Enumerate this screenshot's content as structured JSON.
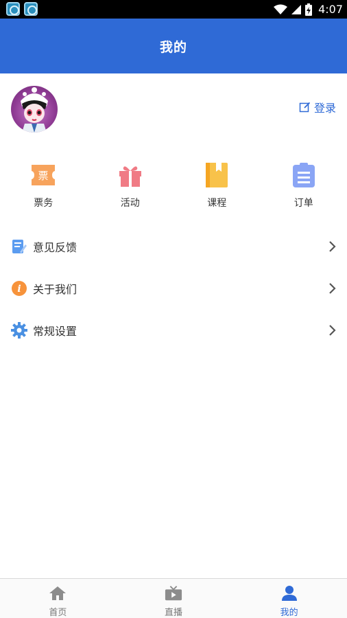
{
  "status_bar": {
    "time": "4:07"
  },
  "header": {
    "title": "我的"
  },
  "profile": {
    "login_label": "登录"
  },
  "shortcuts": [
    {
      "label": "票务",
      "icon": "ticket-icon",
      "color": "#f7a35c",
      "glyph": "票"
    },
    {
      "label": "活动",
      "icon": "gift-icon",
      "color": "#f07b85"
    },
    {
      "label": "课程",
      "icon": "book-icon",
      "color": "#f8c24a"
    },
    {
      "label": "订单",
      "icon": "clipboard-icon",
      "color": "#8aa5f5"
    }
  ],
  "menu": [
    {
      "label": "意见反馈",
      "icon": "feedback-icon"
    },
    {
      "label": "关于我们",
      "icon": "info-icon",
      "glyph": "i"
    },
    {
      "label": "常规设置",
      "icon": "settings-icon"
    }
  ],
  "bottom_nav": [
    {
      "label": "首页",
      "icon": "home-icon"
    },
    {
      "label": "直播",
      "icon": "live-tv-icon"
    },
    {
      "label": "我的",
      "icon": "user-icon",
      "active": true
    }
  ],
  "colors": {
    "primary": "#2f6ad6",
    "inactive_nav": "#8c8c8c"
  }
}
